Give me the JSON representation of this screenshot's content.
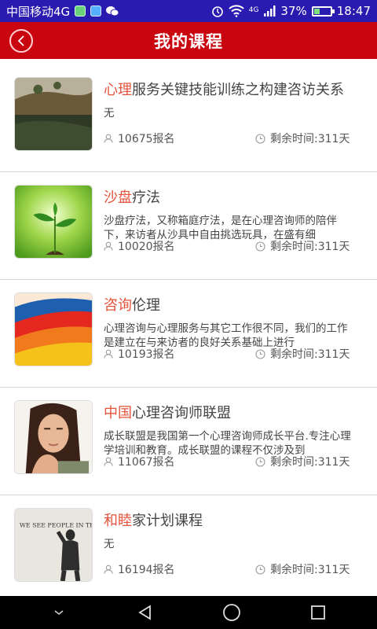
{
  "status_bar": {
    "carrier": "中国移动4G",
    "battery_text": "37%",
    "battery_level": 0.37,
    "time": "18:47",
    "network": "4G",
    "icons": [
      "sms-app-icon",
      "chat-app-icon",
      "wechat-icon",
      "alarm-icon",
      "wifi-icon",
      "signal-icon",
      "battery-icon"
    ]
  },
  "header": {
    "title": "我的课程",
    "back_icon": "back-chevron-icon",
    "bg_color": "#c9050f"
  },
  "courses": [
    {
      "title_highlight": "心理",
      "title_rest": "服务关键技能训练之构建咨访关系",
      "desc": "无",
      "enroll": "10675报名",
      "remaining": "剩余时间:311天",
      "thumb": "landscape-thumbnail"
    },
    {
      "title_highlight": "沙盘",
      "title_rest": "疗法",
      "desc": "沙盘疗法，又称箱庭疗法，是在心理咨询师的陪伴下，来访者从沙具中自由挑选玩具，在盛有细",
      "enroll": "10020报名",
      "remaining": "剩余时间:311天",
      "thumb": "seedling-thumbnail"
    },
    {
      "title_highlight": "咨询",
      "title_rest": "伦理",
      "desc": "心理咨询与心理服务与其它工作很不同，我们的工作是建立在与来访者的良好关系基础上进行",
      "enroll": "10193报名",
      "remaining": "剩余时间:311天",
      "thumb": "paint-strokes-thumbnail"
    },
    {
      "title_highlight": "中国",
      "title_rest": "心理咨询师联盟",
      "desc": "成长联盟是我国第一个心理咨询师成长平台.专注心理学培训和教育。成长联盟的课程不仅涉及到",
      "enroll": "11067报名",
      "remaining": "剩余时间:311天",
      "thumb": "thinking-woman-thumbnail"
    },
    {
      "title_highlight": "和睦",
      "title_rest": "家计划课程",
      "desc": "无",
      "enroll": "16194报名",
      "remaining": "剩余时间:311天",
      "thumb": "wall-writing-thumbnail",
      "thumb_text": "WE SEE PEOPLE IN THE C"
    }
  ],
  "colors": {
    "highlight": "#e5533c",
    "status_bar": "#2a1bb0",
    "header": "#c9050f"
  },
  "nav_bar": {
    "buttons": [
      "hide-keyboard-icon",
      "back-triangle-icon",
      "home-circle-icon",
      "recents-square-icon"
    ]
  }
}
